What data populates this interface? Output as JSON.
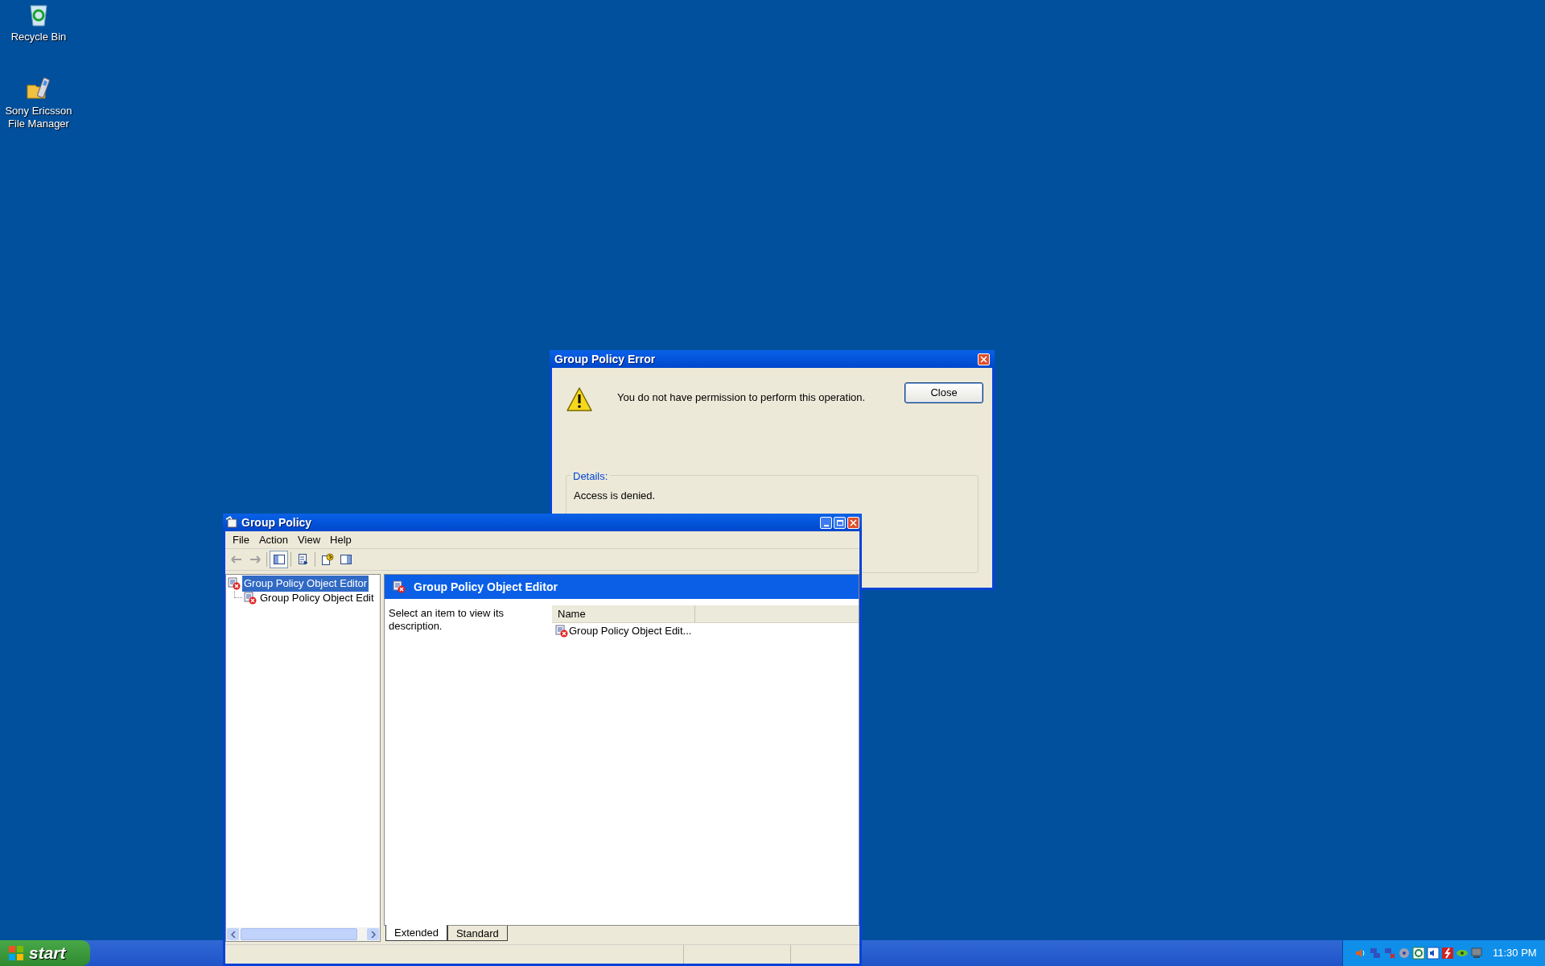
{
  "desktop_icons": [
    {
      "kind": "recycle",
      "label": "Recycle Bin"
    },
    {
      "kind": "phone-folder",
      "label": "Sony Ericsson File Manager"
    }
  ],
  "error_dialog": {
    "title": "Group Policy Error",
    "message": "You do not have permission to perform this operation.",
    "button": "Close",
    "details_label": "Details:",
    "details_text": "Access is denied."
  },
  "window": {
    "title": "Group Policy",
    "menu": [
      "File",
      "Action",
      "View",
      "Help"
    ],
    "toolbar": [
      {
        "kind": "back",
        "disabled": true,
        "pressed": false
      },
      {
        "kind": "forward",
        "disabled": true,
        "pressed": false
      },
      {
        "kind": "tree",
        "disabled": false,
        "pressed": true
      },
      {
        "kind": "export",
        "disabled": false,
        "pressed": false
      },
      {
        "kind": "help",
        "disabled": false,
        "pressed": false
      },
      {
        "kind": "pane",
        "disabled": false,
        "pressed": false
      }
    ],
    "tree": [
      {
        "label": "Group Policy Object Editor",
        "selected": true,
        "children": [
          {
            "label": "Group Policy Object Edit",
            "selected": false
          }
        ]
      }
    ],
    "header_title": "Group Policy Object Editor",
    "description": "Select an item to view its description.",
    "list": {
      "columns": [
        "Name"
      ],
      "rows": [
        {
          "name": "Group Policy Object Edit...",
          "selected": false
        }
      ]
    },
    "tabs": [
      {
        "label": "Extended",
        "selected": true
      },
      {
        "label": "Standard",
        "selected": false
      }
    ]
  },
  "taskbar": {
    "start_label": "start",
    "clock": "11:30 PM"
  }
}
